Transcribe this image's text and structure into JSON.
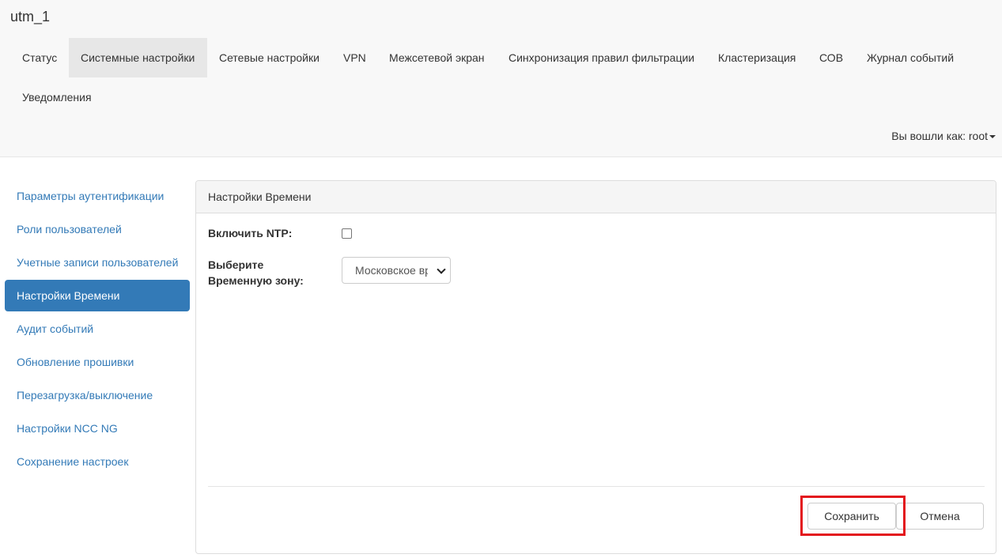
{
  "app": {
    "title": "utm_1"
  },
  "nav": {
    "items": [
      {
        "label": "Статус"
      },
      {
        "label": "Системные настройки"
      },
      {
        "label": "Сетевые настройки"
      },
      {
        "label": "VPN"
      },
      {
        "label": "Межсетевой экран"
      },
      {
        "label": "Синхронизация правил фильтрации"
      },
      {
        "label": "Кластеризация"
      },
      {
        "label": "СОВ"
      },
      {
        "label": "Журнал событий"
      },
      {
        "label": "Уведомления"
      }
    ],
    "user": "Вы вошли как: root"
  },
  "sidebar": {
    "items": [
      {
        "label": "Параметры аутентификации"
      },
      {
        "label": "Роли пользователей"
      },
      {
        "label": "Учетные записи пользователей"
      },
      {
        "label": "Настройки Времени"
      },
      {
        "label": "Аудит событий"
      },
      {
        "label": "Обновление прошивки"
      },
      {
        "label": "Перезагрузка/выключение"
      },
      {
        "label": "Настройки NCC NG"
      },
      {
        "label": "Сохранение настроек"
      }
    ]
  },
  "panel": {
    "title": "Настройки Времени",
    "ntp_label": "Включить NTP:",
    "ntp_enabled": false,
    "tz_label_line1": "Выберите",
    "tz_label_line2": "Временную зону:",
    "tz_value": "Московское время",
    "save_label": "Сохранить",
    "cancel_label": "Отмена"
  },
  "colors": {
    "accent": "#337ab7",
    "highlight": "#e3161d"
  }
}
